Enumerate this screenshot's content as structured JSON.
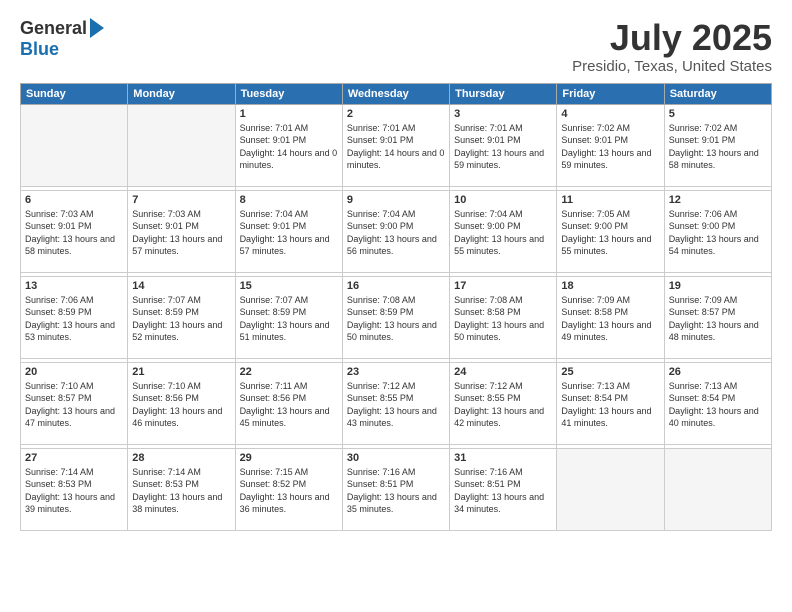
{
  "header": {
    "logo_general": "General",
    "logo_blue": "Blue",
    "month_title": "July 2025",
    "location": "Presidio, Texas, United States"
  },
  "days_of_week": [
    "Sunday",
    "Monday",
    "Tuesday",
    "Wednesday",
    "Thursday",
    "Friday",
    "Saturday"
  ],
  "weeks": [
    [
      {
        "day": "",
        "empty": true
      },
      {
        "day": "",
        "empty": true
      },
      {
        "day": "1",
        "sunrise": "7:01 AM",
        "sunset": "9:01 PM",
        "daylight": "14 hours and 0 minutes."
      },
      {
        "day": "2",
        "sunrise": "7:01 AM",
        "sunset": "9:01 PM",
        "daylight": "14 hours and 0 minutes."
      },
      {
        "day": "3",
        "sunrise": "7:01 AM",
        "sunset": "9:01 PM",
        "daylight": "13 hours and 59 minutes."
      },
      {
        "day": "4",
        "sunrise": "7:02 AM",
        "sunset": "9:01 PM",
        "daylight": "13 hours and 59 minutes."
      },
      {
        "day": "5",
        "sunrise": "7:02 AM",
        "sunset": "9:01 PM",
        "daylight": "13 hours and 58 minutes."
      }
    ],
    [
      {
        "day": "6",
        "sunrise": "7:03 AM",
        "sunset": "9:01 PM",
        "daylight": "13 hours and 58 minutes."
      },
      {
        "day": "7",
        "sunrise": "7:03 AM",
        "sunset": "9:01 PM",
        "daylight": "13 hours and 57 minutes."
      },
      {
        "day": "8",
        "sunrise": "7:04 AM",
        "sunset": "9:01 PM",
        "daylight": "13 hours and 57 minutes."
      },
      {
        "day": "9",
        "sunrise": "7:04 AM",
        "sunset": "9:00 PM",
        "daylight": "13 hours and 56 minutes."
      },
      {
        "day": "10",
        "sunrise": "7:04 AM",
        "sunset": "9:00 PM",
        "daylight": "13 hours and 55 minutes."
      },
      {
        "day": "11",
        "sunrise": "7:05 AM",
        "sunset": "9:00 PM",
        "daylight": "13 hours and 55 minutes."
      },
      {
        "day": "12",
        "sunrise": "7:06 AM",
        "sunset": "9:00 PM",
        "daylight": "13 hours and 54 minutes."
      }
    ],
    [
      {
        "day": "13",
        "sunrise": "7:06 AM",
        "sunset": "8:59 PM",
        "daylight": "13 hours and 53 minutes."
      },
      {
        "day": "14",
        "sunrise": "7:07 AM",
        "sunset": "8:59 PM",
        "daylight": "13 hours and 52 minutes."
      },
      {
        "day": "15",
        "sunrise": "7:07 AM",
        "sunset": "8:59 PM",
        "daylight": "13 hours and 51 minutes."
      },
      {
        "day": "16",
        "sunrise": "7:08 AM",
        "sunset": "8:59 PM",
        "daylight": "13 hours and 50 minutes."
      },
      {
        "day": "17",
        "sunrise": "7:08 AM",
        "sunset": "8:58 PM",
        "daylight": "13 hours and 50 minutes."
      },
      {
        "day": "18",
        "sunrise": "7:09 AM",
        "sunset": "8:58 PM",
        "daylight": "13 hours and 49 minutes."
      },
      {
        "day": "19",
        "sunrise": "7:09 AM",
        "sunset": "8:57 PM",
        "daylight": "13 hours and 48 minutes."
      }
    ],
    [
      {
        "day": "20",
        "sunrise": "7:10 AM",
        "sunset": "8:57 PM",
        "daylight": "13 hours and 47 minutes."
      },
      {
        "day": "21",
        "sunrise": "7:10 AM",
        "sunset": "8:56 PM",
        "daylight": "13 hours and 46 minutes."
      },
      {
        "day": "22",
        "sunrise": "7:11 AM",
        "sunset": "8:56 PM",
        "daylight": "13 hours and 45 minutes."
      },
      {
        "day": "23",
        "sunrise": "7:12 AM",
        "sunset": "8:55 PM",
        "daylight": "13 hours and 43 minutes."
      },
      {
        "day": "24",
        "sunrise": "7:12 AM",
        "sunset": "8:55 PM",
        "daylight": "13 hours and 42 minutes."
      },
      {
        "day": "25",
        "sunrise": "7:13 AM",
        "sunset": "8:54 PM",
        "daylight": "13 hours and 41 minutes."
      },
      {
        "day": "26",
        "sunrise": "7:13 AM",
        "sunset": "8:54 PM",
        "daylight": "13 hours and 40 minutes."
      }
    ],
    [
      {
        "day": "27",
        "sunrise": "7:14 AM",
        "sunset": "8:53 PM",
        "daylight": "13 hours and 39 minutes."
      },
      {
        "day": "28",
        "sunrise": "7:14 AM",
        "sunset": "8:53 PM",
        "daylight": "13 hours and 38 minutes."
      },
      {
        "day": "29",
        "sunrise": "7:15 AM",
        "sunset": "8:52 PM",
        "daylight": "13 hours and 36 minutes."
      },
      {
        "day": "30",
        "sunrise": "7:16 AM",
        "sunset": "8:51 PM",
        "daylight": "13 hours and 35 minutes."
      },
      {
        "day": "31",
        "sunrise": "7:16 AM",
        "sunset": "8:51 PM",
        "daylight": "13 hours and 34 minutes."
      },
      {
        "day": "",
        "empty": true
      },
      {
        "day": "",
        "empty": true
      }
    ]
  ]
}
